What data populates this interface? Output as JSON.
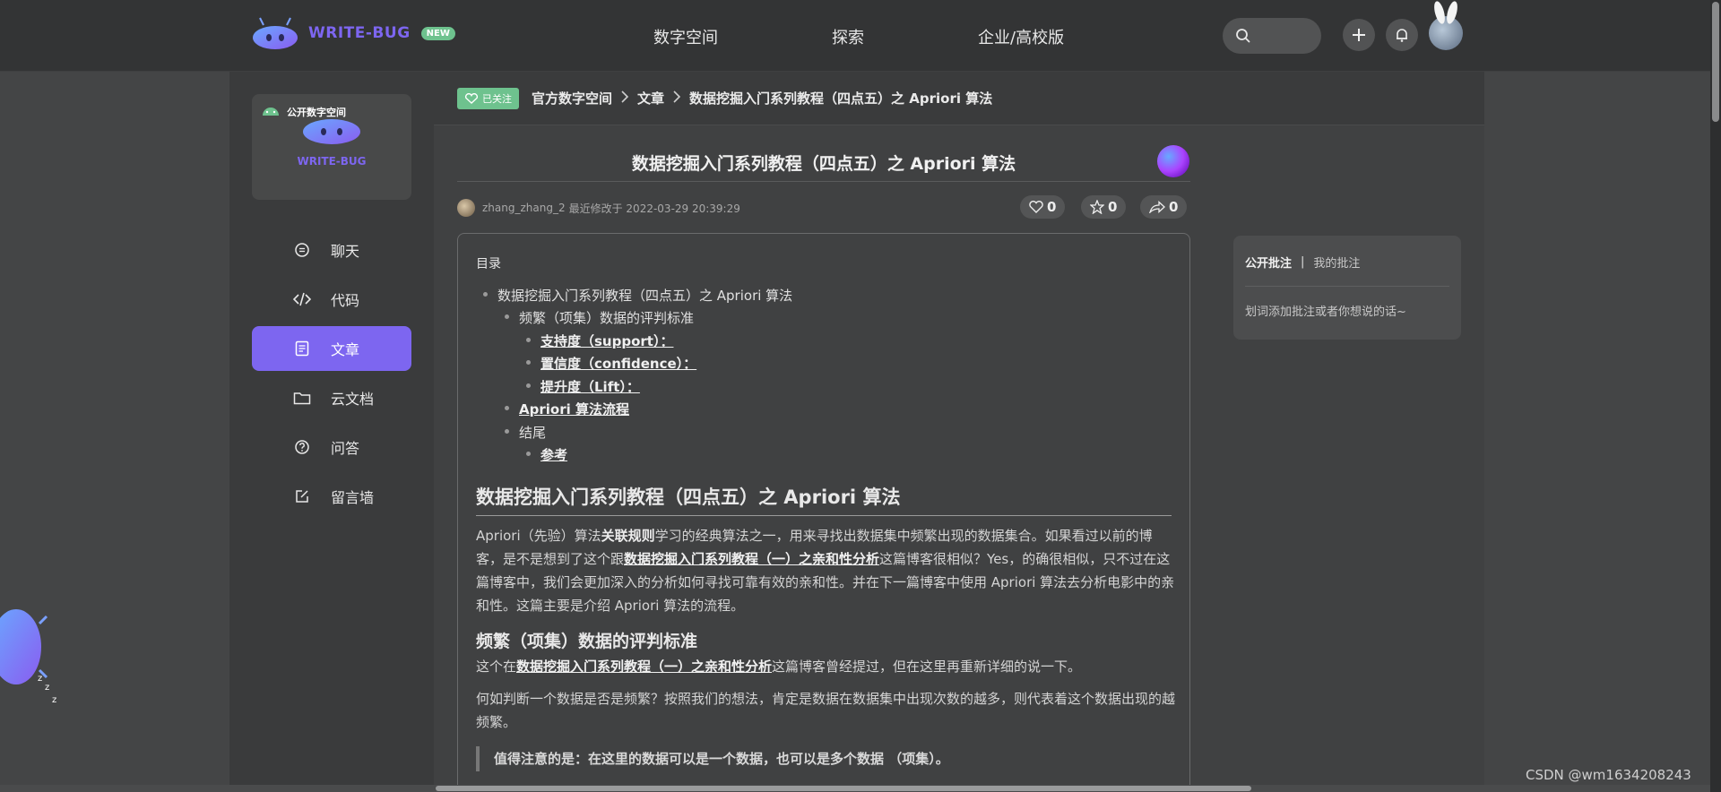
{
  "brand": {
    "name": "WRITE-BUG",
    "badge": "NEW"
  },
  "nav": {
    "items": [
      "数字空间",
      "探索",
      "企业/高校版"
    ]
  },
  "sidebar": {
    "space_card_label": "公开数字空间",
    "space_card_brand": "WRITE-BUG",
    "items": [
      {
        "label": "聊天",
        "icon": "chat-icon"
      },
      {
        "label": "代码",
        "icon": "code-icon"
      },
      {
        "label": "文章",
        "icon": "article-icon",
        "active": true
      },
      {
        "label": "云文档",
        "icon": "folder-icon"
      },
      {
        "label": "问答",
        "icon": "question-icon"
      },
      {
        "label": "留言墙",
        "icon": "edit-icon"
      }
    ]
  },
  "breadcrumb": {
    "follow_label": "已关注",
    "items": [
      "官方数字空间",
      "文章",
      "数据挖掘入门系列教程（四点五）之 Apriori 算法"
    ]
  },
  "article": {
    "title": "数据挖掘入门系列教程（四点五）之 Apriori 算法",
    "author": "zhang_zhang_2",
    "modified_text": "最近修改于 2022-03-29 20:39:29",
    "likes": "0",
    "stars": "0",
    "shares": "0",
    "toc_title": "目录",
    "toc": [
      {
        "text": "数据挖掘入门系列教程（四点五）之 Apriori 算法",
        "level": 0,
        "link": false
      },
      {
        "text": "频繁（项集）数据的评判标准",
        "level": 1,
        "link": false
      },
      {
        "text": "支持度（support）：",
        "level": 2,
        "link": true
      },
      {
        "text": "置信度（confidence）：",
        "level": 2,
        "link": true
      },
      {
        "text": "提升度（Lift）：",
        "level": 2,
        "link": true
      },
      {
        "text": "Apriori 算法流程",
        "level": 1,
        "link": true
      },
      {
        "text": "结尾",
        "level": 1,
        "link": false
      },
      {
        "text": "参考",
        "level": 2,
        "link": true
      }
    ],
    "h1": "数据挖掘入门系列教程（四点五）之 Apriori 算法",
    "p1_a": "Apriori（先验）算法",
    "p1_b": "关联规则",
    "p1_c": "学习的经典算法之一，用来寻找出数据集中频繁出现的数据集合。如果看过以前的博客，是不是想到了这个跟",
    "p1_d": "数据挖掘入门系列教程（一）之亲和性分析",
    "p1_e": "这篇博客很相似？Yes，的确很相似，只不过在这篇博客中，我们会更加深入的分析如何寻找可靠有效的亲和性。并在下一篇博客中使用 Apriori 算法去分析电影中的亲和性。这篇主要是介绍 Apriori 算法的流程。",
    "h2": "频繁（项集）数据的评判标准",
    "p2_a": "这个在",
    "p2_b": "数据挖掘入门系列教程（一）之亲和性分析",
    "p2_c": "这篇博客曾经提过，但在这里再重新详细的说一下。",
    "p3": "何如判断一个数据是否是频繁？按照我们的想法，肯定是数据在数据集中出现次数的越多，则代表着这个数据出现的越频繁。",
    "quote": "值得注意的是：在这里的数据可以是一个数据，也可以是多个数据 （项集）。"
  },
  "annotations": {
    "tab_public": "公开批注",
    "separator": "|",
    "tab_mine": "我的批注",
    "hint": "划词添加批注或者你想说的话~"
  },
  "watermark": "CSDN @wm1634208243"
}
